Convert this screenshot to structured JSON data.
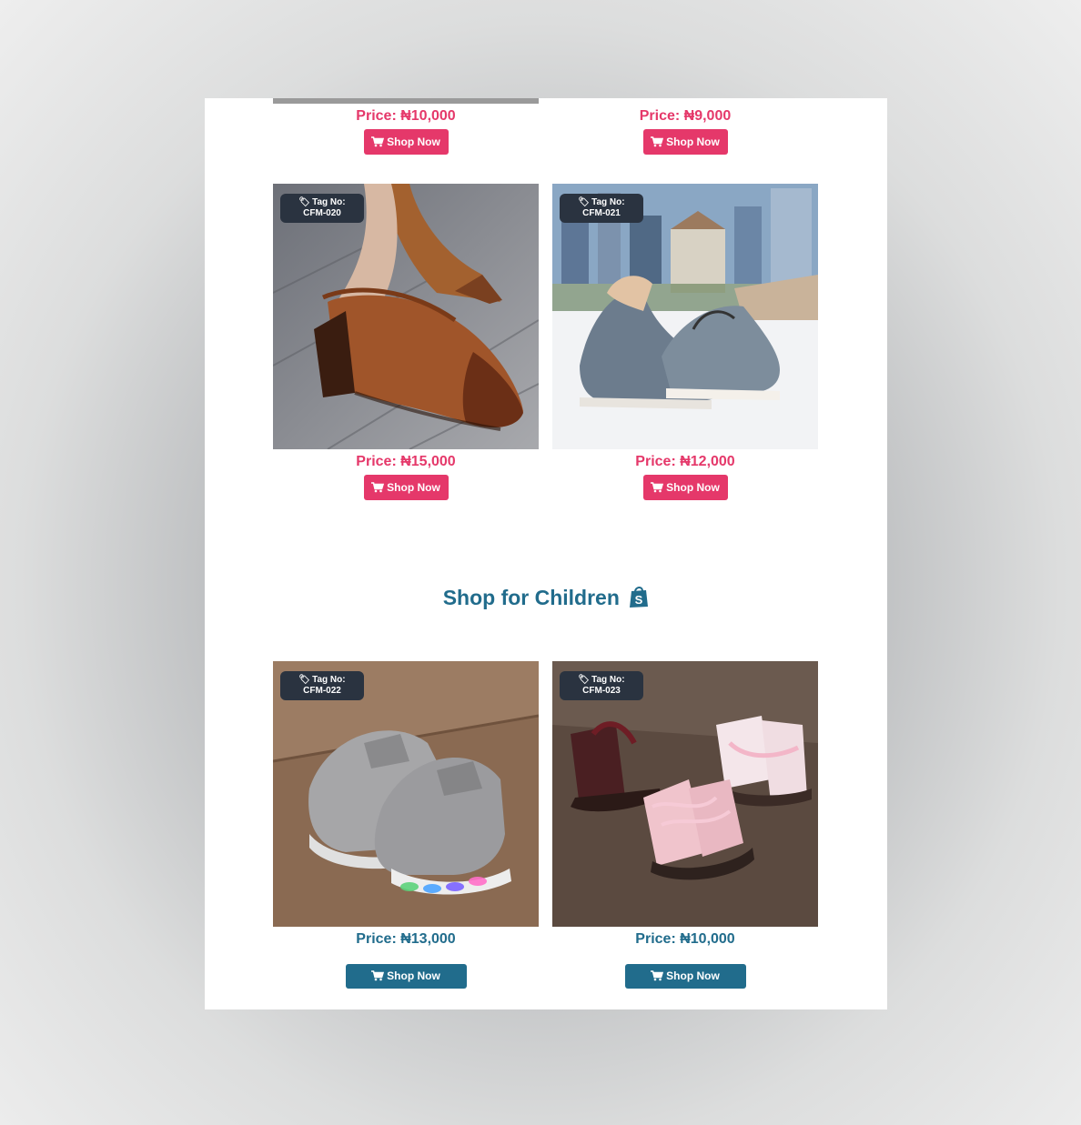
{
  "top_row": [
    {
      "price": "Price: ₦10,000",
      "button": "Shop Now"
    },
    {
      "price": "Price: ₦9,000",
      "button": "Shop Now"
    }
  ],
  "women_row": [
    {
      "tag_label": "Tag No:",
      "tag_code": "CFM-020",
      "price": "Price: ₦15,000",
      "button": "Shop Now",
      "image": "brown-heeled-shoe"
    },
    {
      "tag_label": "Tag No:",
      "tag_code": "CFM-021",
      "price": "Price: ₦12,000",
      "button": "Shop Now",
      "image": "grey-loafer"
    }
  ],
  "children_section": {
    "title": "Shop for Children",
    "icon": "shopify-bag-icon"
  },
  "children_row": [
    {
      "tag_label": "Tag No:",
      "tag_code": "CFM-022",
      "price": "Price: ₦13,000",
      "button": "Shop Now",
      "image": "grey-light-up-sneakers"
    },
    {
      "tag_label": "Tag No:",
      "tag_code": "CFM-023",
      "price": "Price: ₦10,000",
      "button": "Shop Now",
      "image": "pink-and-burgundy-boots"
    }
  ],
  "colors": {
    "accent_pink": "#e5386a",
    "accent_teal": "#216c8c",
    "tag_bg": "#2a3340"
  }
}
